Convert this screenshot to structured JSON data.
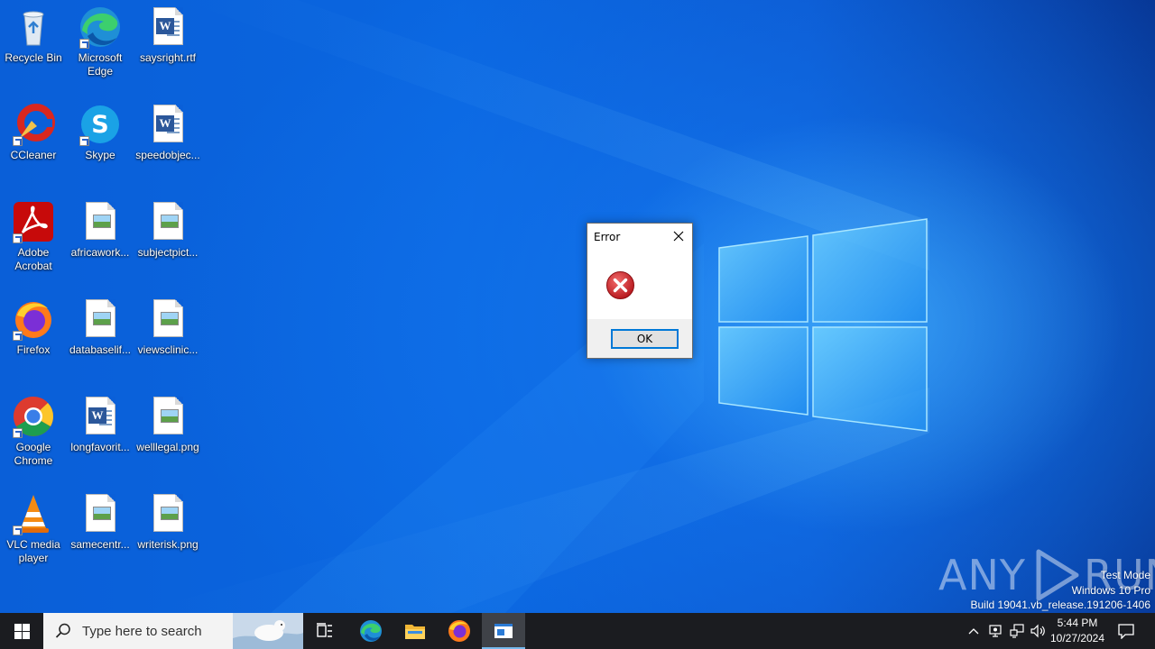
{
  "desktop": {
    "icons": [
      {
        "label": "Recycle Bin",
        "icon": "recycle-bin-icon"
      },
      {
        "label": "Microsoft Edge",
        "icon": "edge-icon"
      },
      {
        "label": "saysright.rtf",
        "icon": "word-document-icon"
      },
      {
        "label": "CCleaner",
        "icon": "ccleaner-icon"
      },
      {
        "label": "Skype",
        "icon": "skype-icon"
      },
      {
        "label": "speedobjec...",
        "icon": "word-document-icon"
      },
      {
        "label": "Adobe Acrobat",
        "icon": "acrobat-icon"
      },
      {
        "label": "africawork...",
        "icon": "image-file-icon"
      },
      {
        "label": "subjectpict...",
        "icon": "image-file-icon"
      },
      {
        "label": "Firefox",
        "icon": "firefox-icon"
      },
      {
        "label": "databaselif...",
        "icon": "image-file-icon"
      },
      {
        "label": "viewsclinic...",
        "icon": "image-file-icon"
      },
      {
        "label": "Google Chrome",
        "icon": "chrome-icon"
      },
      {
        "label": "longfavorit...",
        "icon": "word-document-icon"
      },
      {
        "label": "welllegal.png",
        "icon": "image-file-icon"
      },
      {
        "label": "VLC media player",
        "icon": "vlc-icon"
      },
      {
        "label": "samecentr...",
        "icon": "image-file-icon"
      },
      {
        "label": "writerisk.png",
        "icon": "image-file-icon"
      }
    ]
  },
  "dialog": {
    "title": "Error",
    "ok_label": "OK",
    "icon": "error-icon"
  },
  "watermark": {
    "line1": "Test Mode",
    "line2": "Windows 10 Pro",
    "line3": "Build 19041.vb_release.191206-1406",
    "logo_text_left": "ANY",
    "logo_text_right": "RUN"
  },
  "taskbar": {
    "search_placeholder": "Type here to search",
    "time": "5:44 PM",
    "date": "10/27/2024"
  },
  "colors": {
    "accent": "#0078d7",
    "taskbar_bg": "#1b1c20",
    "error_red": "#d9262b"
  }
}
